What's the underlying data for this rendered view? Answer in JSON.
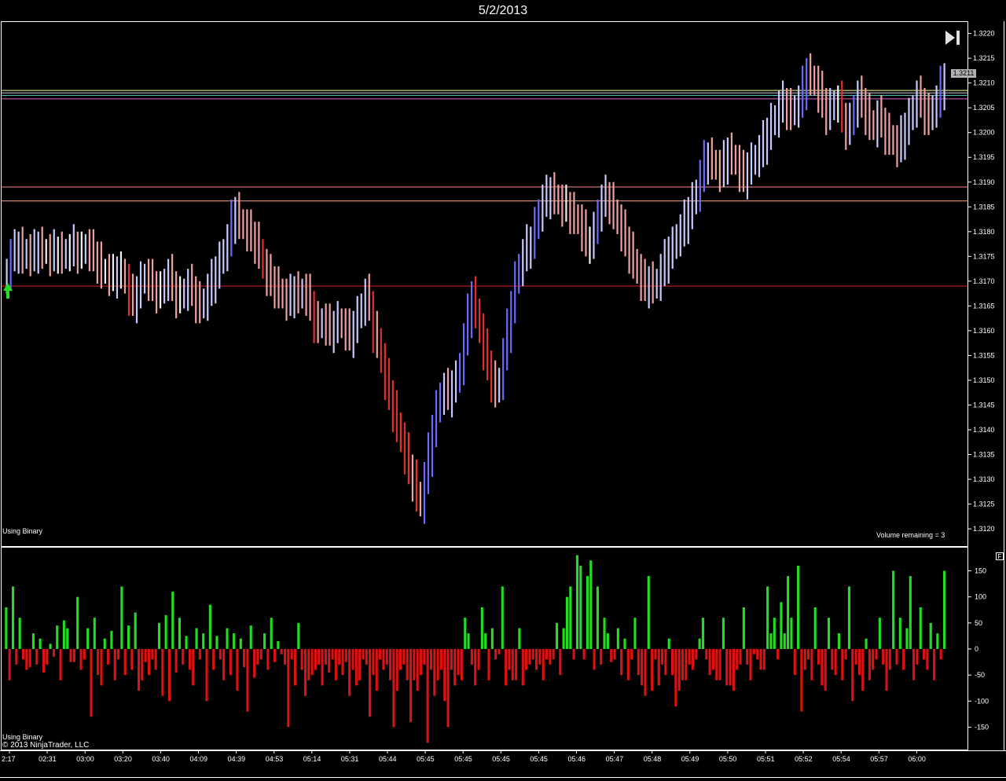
{
  "title": "5/2/2013",
  "panel_labels": {
    "top_indicator": "Using Binary",
    "volume_remaining": "Volume remaining = 3",
    "bottom_indicator": "Using Binary",
    "copyright": "© 2013 NinjaTrader, LLC",
    "panel_button": "F"
  },
  "current_price_label": "1.3211",
  "icons": {
    "goto_end": "skip-to-end-icon",
    "entry_arrow": "green-up-arrow-icon"
  },
  "colors": {
    "background": "#000000",
    "up_bar_strong": "#6a6aff",
    "up_bar_weak": "#c8c8ff",
    "down_bar_strong": "#e03030",
    "down_bar_weak": "#f0a0a0",
    "neutral_bar": "#f0f0f0",
    "positive_hist": "#22dd22",
    "negative_hist": "#dd1111"
  },
  "chart_data": [
    {
      "type": "ohlc",
      "title": "5/2/2013",
      "x_tick_labels": [
        "2:17",
        "02:31",
        "03:00",
        "03:20",
        "03:40",
        "04:09",
        "04:39",
        "04:53",
        "05:14",
        "05:31",
        "05:44",
        "05:45",
        "05:45",
        "05:45",
        "05:45",
        "05:46",
        "05:47",
        "05:48",
        "05:49",
        "05:50",
        "05:51",
        "05:52",
        "05:54",
        "05:57",
        "06:00"
      ],
      "y_tick_labels": [
        "1.3220",
        "1.3215",
        "1.3210",
        "1.3205",
        "1.3200",
        "1.3195",
        "1.3190",
        "1.3185",
        "1.3180",
        "1.3175",
        "1.3170",
        "1.3165",
        "1.3160",
        "1.3155",
        "1.3150",
        "1.3145",
        "1.3140",
        "1.3135",
        "1.3130",
        "1.3125",
        "1.3120"
      ],
      "ylim": [
        1.3117,
        1.3222
      ],
      "horizontal_lines": [
        {
          "price": 1.32085,
          "color": "#ffff99"
        },
        {
          "price": 1.3208,
          "color": "#cccccc"
        },
        {
          "price": 1.32075,
          "color": "#66cccc"
        },
        {
          "price": 1.32068,
          "color": "#cc66cc"
        },
        {
          "price": 1.3189,
          "color": "#ff8888"
        },
        {
          "price": 1.31862,
          "color": "#ffaa88"
        },
        {
          "price": 1.3169,
          "color": "#dd2222"
        }
      ],
      "closes": [
        1.3172,
        1.3175,
        1.3176,
        1.3177,
        1.3175,
        1.3176,
        1.3175,
        1.3176,
        1.3177,
        1.3176,
        1.3176,
        1.3175,
        1.3176,
        1.3176,
        1.3175,
        1.3176,
        1.3176,
        1.3177,
        1.3176,
        1.3176,
        1.3177,
        1.3176,
        1.3175,
        1.3174,
        1.3172,
        1.3172,
        1.3171,
        1.3171,
        1.3172,
        1.3172,
        1.317,
        1.3167,
        1.3166,
        1.3168,
        1.317,
        1.3171,
        1.317,
        1.3169,
        1.3168,
        1.3168,
        1.317,
        1.3171,
        1.3169,
        1.3167,
        1.3167,
        1.3168,
        1.3169,
        1.3168,
        1.3166,
        1.3165,
        1.3166,
        1.3168,
        1.317,
        1.3172,
        1.3174,
        1.3176,
        1.3178,
        1.3182,
        1.3184,
        1.3182,
        1.3181,
        1.318,
        1.3179,
        1.3178,
        1.3176,
        1.3173,
        1.3171,
        1.317,
        1.3169,
        1.3168,
        1.3167,
        1.3166,
        1.3167,
        1.3168,
        1.3167,
        1.3168,
        1.3167,
        1.3165,
        1.3162,
        1.3161,
        1.3162,
        1.3161,
        1.316,
        1.3161,
        1.3162,
        1.3161,
        1.316,
        1.3159,
        1.3161,
        1.3163,
        1.3165,
        1.3167,
        1.3165,
        1.316,
        1.3158,
        1.3154,
        1.315,
        1.3147,
        1.3144,
        1.3141,
        1.3138,
        1.3135,
        1.3132,
        1.313,
        1.3127,
        1.3125,
        1.313,
        1.3135,
        1.314,
        1.3144,
        1.3147,
        1.3148,
        1.3147,
        1.3149,
        1.315,
        1.3153,
        1.3158,
        1.3163,
        1.3167,
        1.3164,
        1.316,
        1.3156,
        1.3153,
        1.315,
        1.3148,
        1.315,
        1.3155,
        1.316,
        1.3165,
        1.317,
        1.3173,
        1.3175,
        1.3177,
        1.3178,
        1.3181,
        1.3184,
        1.3186,
        1.3187,
        1.3188,
        1.3187,
        1.3186,
        1.3185,
        1.3185,
        1.3184,
        1.3183,
        1.3182,
        1.318,
        1.3178,
        1.3178,
        1.318,
        1.3184,
        1.3186,
        1.3187,
        1.3186,
        1.3184,
        1.3182,
        1.318,
        1.3178,
        1.3176,
        1.3174,
        1.3172,
        1.317,
        1.3169,
        1.317,
        1.3169,
        1.317,
        1.3172,
        1.3174,
        1.3176,
        1.3177,
        1.3179,
        1.318,
        1.3182,
        1.3184,
        1.3186,
        1.3188,
        1.3191,
        1.3194,
        1.3195,
        1.3194,
        1.3193,
        1.3192,
        1.3194,
        1.3196,
        1.3195,
        1.3194,
        1.3192,
        1.3191,
        1.3193,
        1.3194,
        1.3195,
        1.3196,
        1.3198,
        1.32,
        1.3202,
        1.3203,
        1.3205,
        1.3206,
        1.3205,
        1.3204,
        1.3205,
        1.3206,
        1.3209,
        1.3212,
        1.3211,
        1.321,
        1.3208,
        1.3206,
        1.3204,
        1.3205,
        1.3206,
        1.3206,
        1.3203,
        1.3201,
        1.3202,
        1.3205,
        1.3207,
        1.3206,
        1.3204,
        1.3202,
        1.3201,
        1.3203,
        1.3202,
        1.32,
        1.3199,
        1.3198,
        1.3197,
        1.3199,
        1.3201,
        1.3203,
        1.3205,
        1.3207,
        1.3206,
        1.3204,
        1.3203,
        1.3205,
        1.3206,
        1.3209,
        1.3211
      ],
      "histogram": {
        "ylim": [
          -190,
          190
        ],
        "y_tick_labels": [
          "150",
          "100",
          "50",
          "0",
          "-50",
          "-100",
          "-150"
        ],
        "values": [
          80,
          -60,
          120,
          -30,
          60,
          -20,
          -40,
          -35,
          30,
          -30,
          20,
          -45,
          -30,
          10,
          -15,
          45,
          -60,
          55,
          40,
          -25,
          -25,
          100,
          -40,
          -20,
          40,
          -130,
          60,
          -50,
          -70,
          20,
          -30,
          35,
          -60,
          -20,
          120,
          -50,
          45,
          -40,
          70,
          -80,
          -60,
          -25,
          -50,
          -20,
          -40,
          50,
          -90,
          65,
          -100,
          110,
          -45,
          60,
          -30,
          25,
          -40,
          -70,
          40,
          -20,
          30,
          -100,
          85,
          -40,
          25,
          -20,
          -60,
          40,
          -50,
          30,
          -80,
          20,
          -35,
          -120,
          45,
          -55,
          -30,
          -20,
          30,
          -40,
          60,
          -25,
          15,
          -10,
          -30,
          -150,
          -20,
          -70,
          50,
          -40,
          -90,
          -60,
          -50,
          -40,
          -30,
          -70,
          -30,
          -45,
          -20,
          -60,
          -30,
          -50,
          -25,
          -90,
          -40,
          -70,
          -60,
          -20,
          -30,
          -130,
          -50,
          -80,
          -20,
          -40,
          -30,
          -60,
          -150,
          -80,
          -40,
          -30,
          -60,
          -140,
          -60,
          -80,
          -50,
          -30,
          -180,
          -40,
          -90,
          -60,
          -40,
          -100,
          -150,
          -40,
          -70,
          -50,
          -60,
          60,
          30,
          -30,
          -70,
          -40,
          80,
          30,
          -60,
          40,
          -20,
          -10,
          120,
          -70,
          -40,
          -60,
          -60,
          40,
          -70,
          -40,
          -30,
          -20,
          -40,
          -30,
          -60,
          -20,
          -30,
          -20,
          50,
          -50,
          40,
          100,
          120,
          -20,
          180,
          160,
          -20,
          140,
          170,
          -40,
          120,
          -30,
          60,
          30,
          -25,
          -20,
          40,
          -50,
          20,
          -60,
          -20,
          60,
          -50,
          -70,
          -90,
          140,
          -80,
          -20,
          -70,
          -30,
          -50,
          20,
          -50,
          -110,
          -80,
          -60,
          -60,
          -30,
          -40,
          -20,
          20,
          60,
          -20,
          -50,
          -40,
          -60,
          -60,
          60,
          -70,
          -70,
          -80,
          -40,
          -30,
          80,
          -30,
          -60,
          -10,
          -20,
          -40,
          -40,
          120,
          30,
          60,
          -20,
          90,
          30,
          140,
          60,
          -50,
          160,
          -120,
          -40,
          -20,
          -60,
          80,
          -30,
          -70,
          -80,
          60,
          -40,
          -50,
          30,
          -60,
          -20,
          120,
          -100,
          -30,
          -50,
          -80,
          20,
          -60,
          -40,
          -20,
          60,
          -30,
          -80,
          -40,
          150,
          -30,
          60,
          -40,
          40,
          140,
          -60,
          -30,
          80,
          -20,
          -40,
          50,
          -60,
          30,
          -20,
          150
        ]
      }
    }
  ]
}
